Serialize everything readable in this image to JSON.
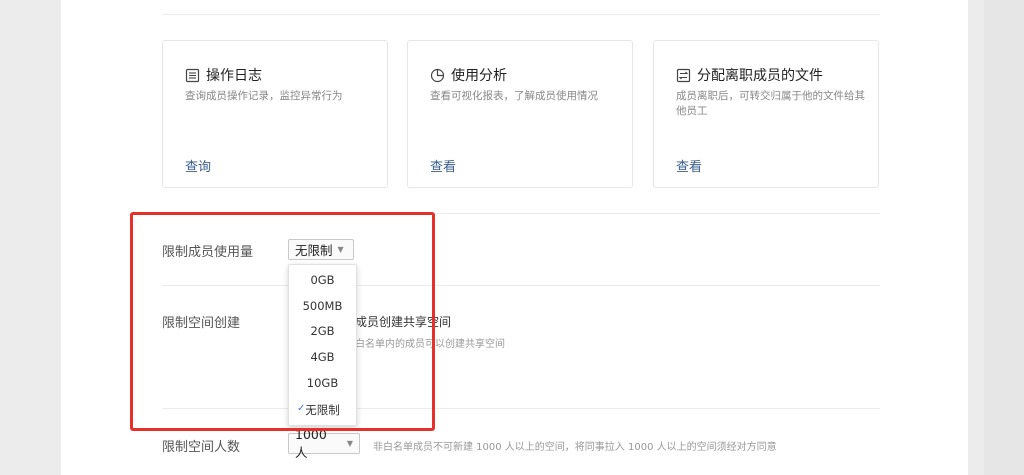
{
  "cards": [
    {
      "title": "操作日志",
      "desc": "查询成员操作记录，监控异常行为",
      "link": "查询",
      "icon": "log-list-icon"
    },
    {
      "title": "使用分析",
      "desc": "查看可视化报表，了解成员使用情况",
      "link": "查看",
      "icon": "pie-chart-icon"
    },
    {
      "title": "分配离职成员的文件",
      "desc": "成员离职后，可转交归属于他的文件给其他员工",
      "link": "查看",
      "icon": "transfer-icon"
    }
  ],
  "usage_limit": {
    "label": "限制成员使用量",
    "selected": "无限制",
    "options": [
      "0GB",
      "500MB",
      "2GB",
      "4GB",
      "10GB",
      "无限制"
    ]
  },
  "space_creation": {
    "label": "限制空间创建",
    "option_title": "成员创建共享空间",
    "option_desc": "白名单内的成员可以创建共享空间"
  },
  "space_members": {
    "label": "限制空间人数",
    "selected": "1000 人",
    "note": "非白名单成员不可新建 1000 人以上的空间，将同事拉入 1000 人以上的空间须经对方同意"
  },
  "colors": {
    "accent_link": "#3a5e8c",
    "highlight_border": "#e8302a",
    "check": "#3a7bd5"
  }
}
